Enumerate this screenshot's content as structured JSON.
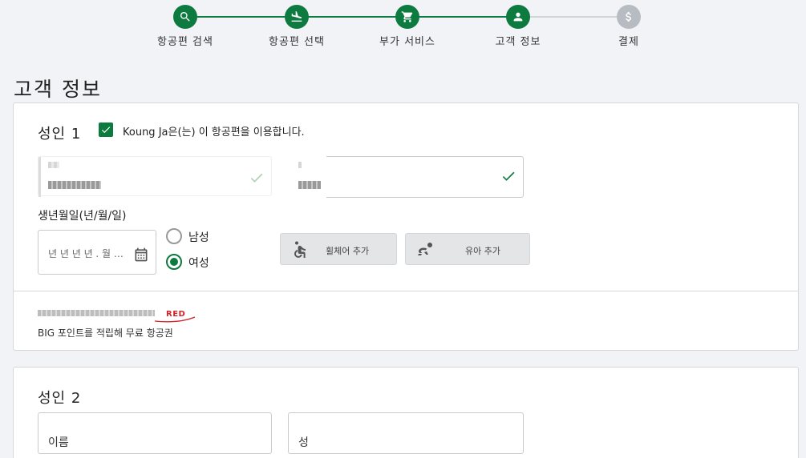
{
  "stepper": {
    "steps": [
      {
        "label": "항공편 검색",
        "icon": "search-icon",
        "state": "done"
      },
      {
        "label": "항공편 선택",
        "icon": "airplane-landing-icon",
        "state": "done"
      },
      {
        "label": "부가 서비스",
        "icon": "cart-icon",
        "state": "done"
      },
      {
        "label": "고객 정보",
        "icon": "person-icon",
        "state": "current"
      },
      {
        "label": "결제",
        "icon": "dollar-icon",
        "state": "pending"
      }
    ],
    "active_color": "#0d7a3f",
    "pending_color": "#b7bcc2"
  },
  "page": {
    "title": "고객 정보"
  },
  "passenger1": {
    "title": "성인 1",
    "checkbox_label": "Koung Ja은(는) 이 항공편을 이용합니다.",
    "checked": true,
    "dob_label": "생년월일(년/월/일)",
    "dob_placeholder": "년 년 년 년 . 월 월 . 일 일",
    "gender_male": "남성",
    "gender_female": "여성",
    "gender_selected": "여성",
    "wheelchair_button": "휠체어 추가",
    "infant_button": "유아 추가",
    "red_label": "RED",
    "big_points_text": "BIG 포인트를 적립해 무료 항공권"
  },
  "passenger2": {
    "title": "성인 2",
    "first_name_label": "이름",
    "last_name_label": "성"
  }
}
